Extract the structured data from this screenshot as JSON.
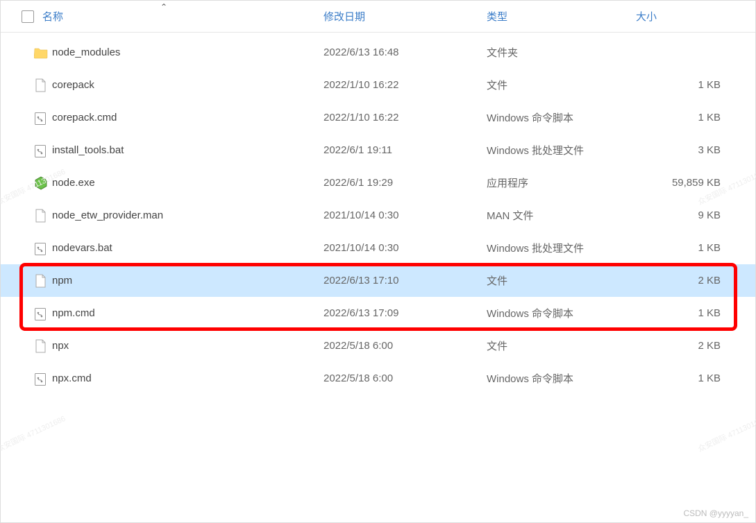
{
  "header": {
    "name": "名称",
    "date": "修改日期",
    "type": "类型",
    "size": "大小"
  },
  "files": [
    {
      "name": "node_modules",
      "date": "2022/6/13 16:48",
      "type": "文件夹",
      "size": "",
      "icon": "folder",
      "selected": false,
      "highlight": false
    },
    {
      "name": "corepack",
      "date": "2022/1/10 16:22",
      "type": "文件",
      "size": "1 KB",
      "icon": "file",
      "selected": false,
      "highlight": false
    },
    {
      "name": "corepack.cmd",
      "date": "2022/1/10 16:22",
      "type": "Windows 命令脚本",
      "size": "1 KB",
      "icon": "cmd",
      "selected": false,
      "highlight": false
    },
    {
      "name": "install_tools.bat",
      "date": "2022/6/1 19:11",
      "type": "Windows 批处理文件",
      "size": "3 KB",
      "icon": "cmd",
      "selected": false,
      "highlight": false
    },
    {
      "name": "node.exe",
      "date": "2022/6/1 19:29",
      "type": "应用程序",
      "size": "59,859 KB",
      "icon": "node",
      "selected": false,
      "highlight": false
    },
    {
      "name": "node_etw_provider.man",
      "date": "2021/10/14 0:30",
      "type": "MAN 文件",
      "size": "9 KB",
      "icon": "file",
      "selected": false,
      "highlight": false
    },
    {
      "name": "nodevars.bat",
      "date": "2021/10/14 0:30",
      "type": "Windows 批处理文件",
      "size": "1 KB",
      "icon": "cmd",
      "selected": false,
      "highlight": false
    },
    {
      "name": "npm",
      "date": "2022/6/13 17:10",
      "type": "文件",
      "size": "2 KB",
      "icon": "file",
      "selected": true,
      "highlight": true
    },
    {
      "name": "npm.cmd",
      "date": "2022/6/13 17:09",
      "type": "Windows 命令脚本",
      "size": "1 KB",
      "icon": "cmd",
      "selected": false,
      "highlight": true
    },
    {
      "name": "npx",
      "date": "2022/5/18 6:00",
      "type": "文件",
      "size": "2 KB",
      "icon": "file",
      "selected": false,
      "highlight": false
    },
    {
      "name": "npx.cmd",
      "date": "2022/5/18 6:00",
      "type": "Windows 命令脚本",
      "size": "1 KB",
      "icon": "cmd",
      "selected": false,
      "highlight": false
    }
  ],
  "credit": "CSDN @yyyyan_",
  "watermark": "众安国际 4711301686"
}
